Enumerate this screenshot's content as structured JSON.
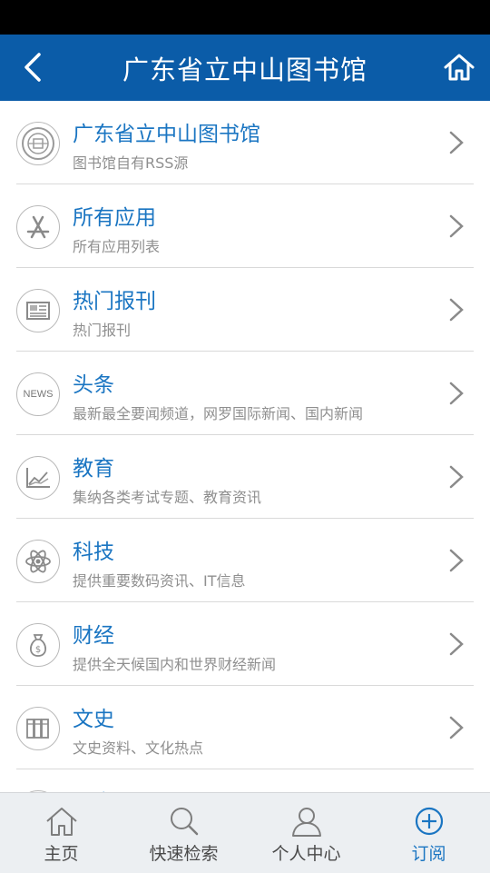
{
  "header": {
    "title": "广东省立中山图书馆",
    "back_icon": "chevron-left-icon",
    "home_icon": "home-icon"
  },
  "list": [
    {
      "title": "广东省立中山图书馆",
      "subtitle": "图书馆自有RSS源",
      "icon": "library-seal-icon"
    },
    {
      "title": "所有应用",
      "subtitle": "所有应用列表",
      "icon": "app-store-icon"
    },
    {
      "title": "热门报刊",
      "subtitle": "热门报刊",
      "icon": "newspaper-icon"
    },
    {
      "title": "头条",
      "subtitle": "最新最全要闻频道，网罗国际新闻、国内新闻",
      "icon": "news-icon",
      "icon_text": "NEWS"
    },
    {
      "title": "教育",
      "subtitle": "集纳各类考试专题、教育资讯",
      "icon": "chart-icon"
    },
    {
      "title": "科技",
      "subtitle": "提供重要数码资讯、IT信息",
      "icon": "atom-icon"
    },
    {
      "title": "财经",
      "subtitle": "提供全天候国内和世界财经新闻",
      "icon": "money-bag-icon"
    },
    {
      "title": "文史",
      "subtitle": "文史资料、文化热点",
      "icon": "books-icon"
    },
    {
      "title": "人文",
      "subtitle": "",
      "icon": "culture-icon"
    }
  ],
  "tabbar": [
    {
      "label": "主页",
      "icon": "home-icon",
      "active": false
    },
    {
      "label": "快速检索",
      "icon": "search-icon",
      "active": false
    },
    {
      "label": "个人中心",
      "icon": "user-icon",
      "active": false
    },
    {
      "label": "订阅",
      "icon": "plus-circle-icon",
      "active": true
    }
  ],
  "colors": {
    "header_bg": "#0b5ca8",
    "accent": "#1a75c2",
    "subtitle": "#8f8f8f",
    "tabbar_bg": "#eceff2"
  }
}
